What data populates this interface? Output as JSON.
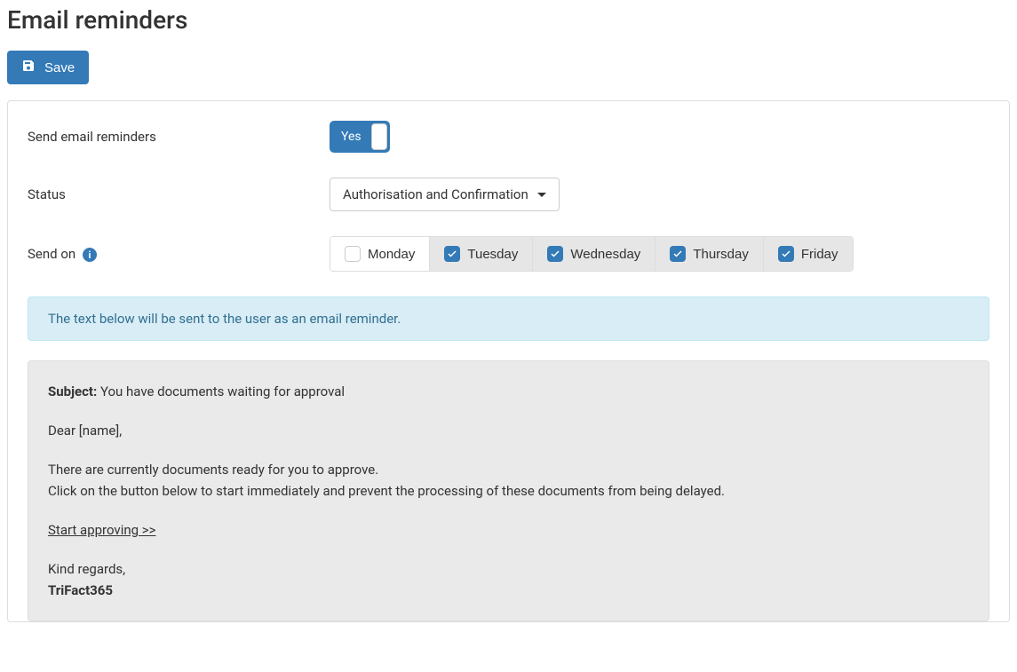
{
  "page": {
    "title": "Email reminders"
  },
  "actions": {
    "save_label": "Save"
  },
  "form": {
    "send_reminders": {
      "label": "Send email reminders",
      "toggle_value": "Yes"
    },
    "status": {
      "label": "Status",
      "selected": "Authorisation and Confirmation"
    },
    "send_on": {
      "label": "Send on",
      "days": [
        {
          "name": "Monday",
          "checked": false
        },
        {
          "name": "Tuesday",
          "checked": true
        },
        {
          "name": "Wednesday",
          "checked": true
        },
        {
          "name": "Thursday",
          "checked": true
        },
        {
          "name": "Friday",
          "checked": true
        }
      ]
    }
  },
  "info_text": "The text below will be sent to the user as an email reminder.",
  "email": {
    "subject_label": "Subject:",
    "subject_value": "You have documents waiting for approval",
    "greeting": "Dear [name],",
    "body_line1": "There are currently documents ready for you to approve.",
    "body_line2": "Click on the button below to start immediately and prevent the processing of these documents from being delayed.",
    "cta": "Start approving >>",
    "signoff": "Kind regards,",
    "sender": "TriFact365"
  }
}
